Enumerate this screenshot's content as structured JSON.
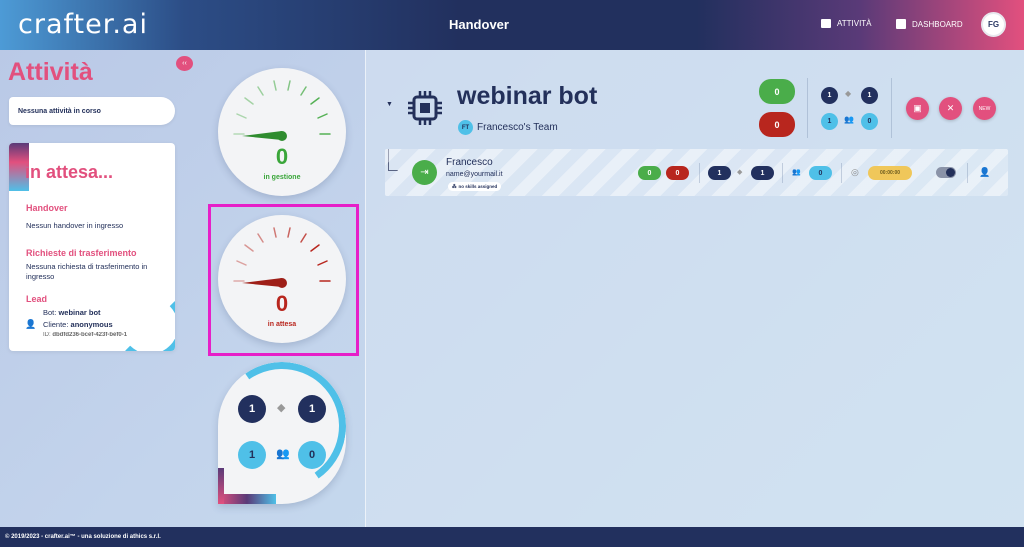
{
  "header": {
    "logo": "crafter.ai",
    "title": "Handover",
    "nav_activity": "ATTIVITÀ",
    "nav_dashboard": "DASHBOARD",
    "avatar": "FG"
  },
  "sidebar": {
    "title": "Attività",
    "collapse_label": "‹‹",
    "no_activity": "Nessuna attività in corso",
    "waiting": {
      "title": "in attesa...",
      "handover_heading": "Handover",
      "handover_text": "Nessun handover in ingresso",
      "transfer_heading": "Richieste di trasferimento",
      "transfer_text": "Nessuna richiesta di trasferimento in ingresso",
      "lead_heading": "Lead",
      "bot_label": "Bot:",
      "bot_value": "webinar bot",
      "client_label": "Cliente:",
      "client_value": "anonymous",
      "id_label": "ID:",
      "id_value": "dbdfd236-bcef-423f-bef0-1"
    }
  },
  "gauges": {
    "managed": {
      "value": "0",
      "label": "in gestione",
      "color": "#3aa63a"
    },
    "waiting": {
      "value": "0",
      "label": "in attesa",
      "color": "#b8261e"
    },
    "counts": {
      "top_left": "1",
      "top_right": "1",
      "bottom_left": "1",
      "bottom_right": "0"
    }
  },
  "bot": {
    "name": "webinar bot",
    "team_badge": "FT",
    "team": "Francesco's Team",
    "green_count": "0",
    "red_count": "0",
    "dark_a": "1",
    "dark_b": "1",
    "light_a": "1",
    "light_b": "0",
    "action_new": "NEW"
  },
  "operator": {
    "name": "Francesco",
    "email": "name@yourmail.it",
    "skills": "no skills assigned",
    "green": "0",
    "red": "0",
    "dark_a": "1",
    "dark_b": "1",
    "light": "0",
    "timer": "00:00:00"
  },
  "footer": {
    "text": "© 2019/2023 - crafter.ai™ - una soluzione di athics s.r.l."
  }
}
